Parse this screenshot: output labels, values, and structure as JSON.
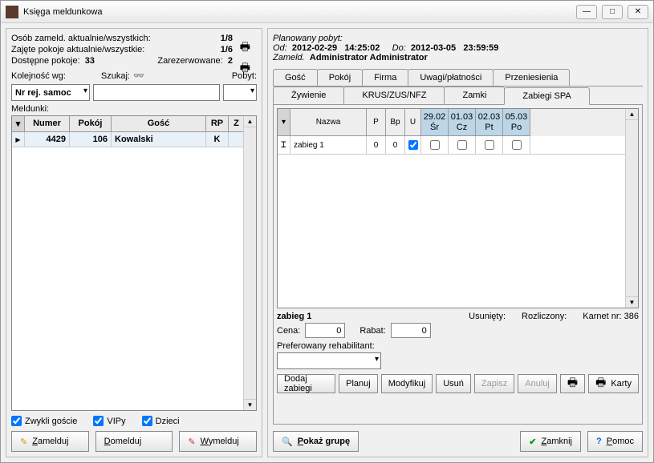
{
  "window": {
    "title": "Księga meldunkowa"
  },
  "stats": {
    "row1_label": "Osób zameld. aktualnie/wszystkich:",
    "row1_value": "1/8",
    "row2_label": "Zajęte pokoje aktualnie/wszystkie:",
    "row2_value": "1/6",
    "avail_label": "Dostępne pokoje:",
    "avail_value": "33",
    "reserved_label": "Zarezerwowane:",
    "reserved_value": "2"
  },
  "search": {
    "order_label": "Kolejność wg:",
    "order_value": "Nr rej. samoc",
    "search_label": "Szukaj:",
    "search_value": "",
    "pobyt_label": "Pobyt:",
    "pobyt_value": ""
  },
  "meldunki": {
    "label": "Meldunki:",
    "cols": {
      "numer": "Numer",
      "pokoj": "Pokój",
      "gosc": "Gość",
      "rp": "RP",
      "z": "Z"
    },
    "rows": [
      {
        "numer": "4429",
        "pokoj": "106",
        "gosc": "Kowalski",
        "rp": "K",
        "z": ""
      }
    ]
  },
  "filters": {
    "zwykli": "Zwykli goście",
    "vipy": "VIPy",
    "dzieci": "Dzieci"
  },
  "left_buttons": {
    "zamelduj": "Zamelduj",
    "domelduj": "Domelduj",
    "wymelduj": "Wymelduj"
  },
  "plan": {
    "header": "Planowany pobyt:",
    "od_label": "Od:",
    "od_date": "2012-02-29",
    "od_time": "14:25:02",
    "do_label": "Do:",
    "do_date": "2012-03-05",
    "do_time": "23:59:59",
    "zameld_label": "Zameld.",
    "zameld_value": "Administrator Administrator"
  },
  "tabs1": [
    "Gość",
    "Pokój",
    "Firma",
    "Uwagi/płatności",
    "Przeniesienia"
  ],
  "tabs2": [
    "Żywienie",
    "KRUS/ZUS/NFZ",
    "Zamki",
    "Zabiegi SPA"
  ],
  "active_tab2": "Zabiegi SPA",
  "spa": {
    "headers": {
      "nazwa": "Nazwa",
      "p": "P",
      "bp": "Bp",
      "u": "U"
    },
    "days": [
      {
        "date": "29.02",
        "dow": "Śr"
      },
      {
        "date": "01.03",
        "dow": "Cz"
      },
      {
        "date": "02.03",
        "dow": "Pt"
      },
      {
        "date": "05.03",
        "dow": "Po"
      }
    ],
    "rows": [
      {
        "nazwa": "zabieg 1",
        "p": "0",
        "bp": "0",
        "u": true,
        "days": [
          false,
          false,
          false,
          false
        ]
      }
    ]
  },
  "detail": {
    "name": "zabieg 1",
    "usuniety_label": "Usunięty:",
    "rozliczony_label": "Rozliczony:",
    "karnet_label": "Karnet nr:",
    "karnet_value": "386",
    "cena_label": "Cena:",
    "cena_value": "0",
    "rabat_label": "Rabat:",
    "rabat_value": "0",
    "rehab_label": "Preferowany rehabilitant:",
    "rehab_value": ""
  },
  "spa_buttons": {
    "dodaj": "Dodaj zabiegi",
    "planuj": "Planuj",
    "modyfikuj": "Modyfikuj",
    "usun": "Usuń",
    "zapisz": "Zapisz",
    "anuluj": "Anuluj",
    "karty": "Karty"
  },
  "bottom": {
    "pokaz": "Pokaż grupę",
    "zamknij": "Zamknij",
    "pomoc": "Pomoc"
  }
}
